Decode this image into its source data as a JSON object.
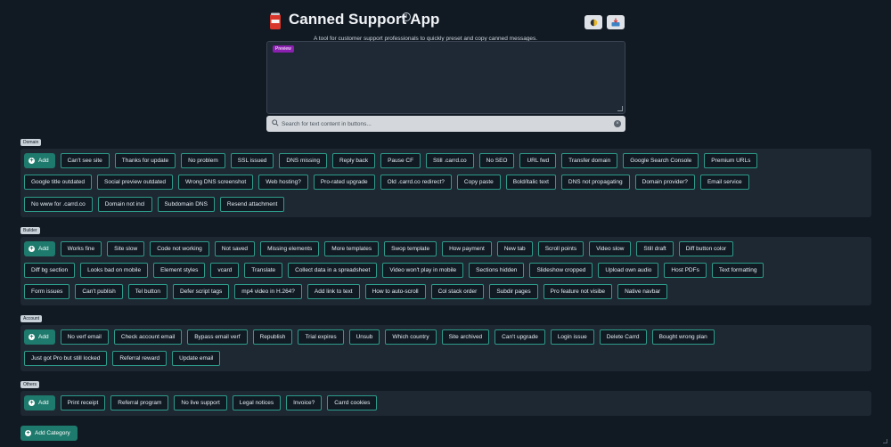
{
  "header": {
    "title": "Canned Support App",
    "subtitle": "A tool for customer support professionals to quickly preset and copy canned messages."
  },
  "preview": {
    "badge": "Preview"
  },
  "search": {
    "placeholder": "Search for text content in buttons..."
  },
  "add_label": "Add",
  "add_category_label": "Add Category",
  "icons": {
    "app": "soda-can-icon",
    "info": "info-icon",
    "theme": "half-moon-icon",
    "share": "inbox-tray-icon",
    "search": "search-icon",
    "clear": "clear-icon"
  },
  "colors": {
    "background": "#111923",
    "panel": "#1e2833",
    "accent": "#1d7a6c",
    "button_border": "#2d9c8a",
    "badge": "#8a1fb0"
  },
  "categories": [
    {
      "label": "Domain",
      "rows": [
        [
          "Can't see site",
          "Thanks for update",
          "No problem",
          "SSL issued",
          "DNS missing",
          "Reply back",
          "Pause CF",
          "Still .carrd.co",
          "No SEO",
          "URL fwd",
          "Transfer domain",
          "Google Search Console",
          "Premium URLs"
        ],
        [
          "Google title outdated",
          "Social preview outdated",
          "Wrong DNS screenshot",
          "Web hosting?",
          "Pro-rated upgrade",
          "Old .carrd.co redirect?",
          "Copy paste",
          "Bold/italic text",
          "DNS not propagating",
          "Domain provider?",
          "Email service"
        ],
        [
          "No www for .carrd.co",
          "Domain not incl",
          "Subdomain DNS",
          "Resend attachment"
        ]
      ]
    },
    {
      "label": "Builder",
      "rows": [
        [
          "Works fine",
          "Site slow",
          "Code not working",
          "Not saved",
          "Missing elements",
          "More templates",
          "Swop template",
          "How payment",
          "New tab",
          "Scroll points",
          "Video slow",
          "Still draft",
          "Diff button color"
        ],
        [
          "Diff bg section",
          "Looks bad on mobile",
          "Element styles",
          "vcard",
          "Translate",
          "Collect data in a spreadsheet",
          "Video won't play in mobile",
          "Sections hidden",
          "Slideshow cropped",
          "Upload own audio",
          "Host PDFs",
          "Text formatting"
        ],
        [
          "Form issues",
          "Can't publish",
          "Tel button",
          "Defer script tags",
          "mp4 video in H.264?",
          "Add link to text",
          "How to auto-scroll",
          "Col stack order",
          "Subdir pages",
          "Pro feature not visibe",
          "Native navbar"
        ]
      ]
    },
    {
      "label": "Account",
      "rows": [
        [
          "No verf email",
          "Check account email",
          "Bypass email verf",
          "Republish",
          "Trial expires",
          "Unsub",
          "Which country",
          "Site archived",
          "Can't upgrade",
          "Login issue",
          "Delete Carrd",
          "Bought wrong plan"
        ],
        [
          "Just got Pro but still locked",
          "Referral reward",
          "Update email"
        ]
      ]
    },
    {
      "label": "Others",
      "rows": [
        [
          "Print receipt",
          "Referral program",
          "No live support",
          "Legal notices",
          "Invoice?",
          "Carrd cookies"
        ]
      ]
    }
  ]
}
